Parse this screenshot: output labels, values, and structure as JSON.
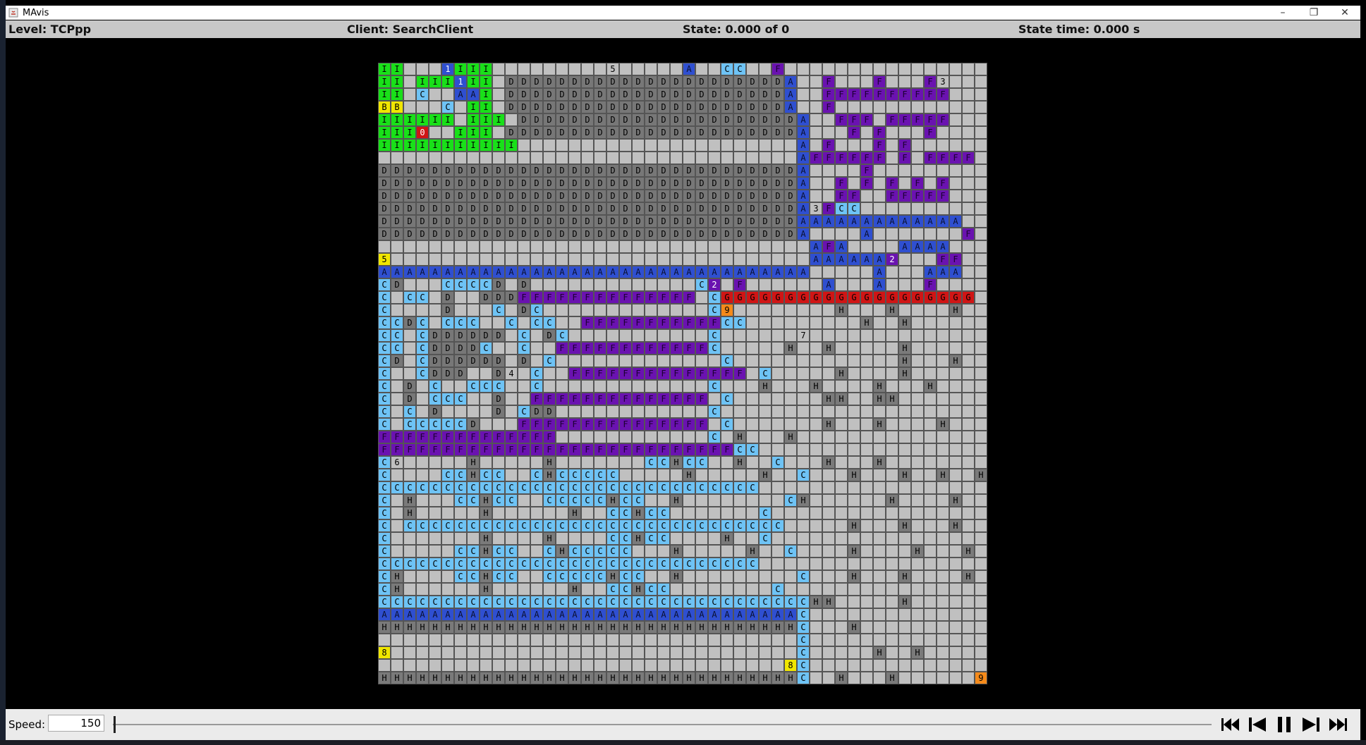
{
  "window": {
    "title": "MAvis"
  },
  "info": {
    "level": "Level: TCPpp",
    "client": "Client: SearchClient",
    "state": "State: 0.000 of 0",
    "state_time": "State time: 0.000 s"
  },
  "colors": {
    "A": "#2f4fd0",
    "B": "#f0e600",
    "C": "#6ec3f5",
    "D": "#777777",
    "E": "#d01515",
    "F": "#6a12b0",
    "G": "#d01515",
    "H": "#7a7a7a",
    "I": "#19e019",
    "8": "#f0e600",
    "9": "#f58a1a",
    "empty": "#c0c0c0",
    "wall": "#000000"
  },
  "grid_rows": [
    "II   1III         5     A  CC  F ",
    "II III1II DDDDDDDDDDDDDDDDDDDDDDA  F   F   F3",
    "II C  AAI DDDDDDDDDDDDDDDDDDDDDDA  FFFFFFFFFF",
    "BB   C II DDDDDDDDDDDDDDDDDDDDDDA  F ",
    "IIIIII III DDDDDDDDDDDDDDDDDDDDDDA  FFF FFFFF",
    "III0  III DDDDDDDDDDDDDDDDDDDDDDDA   F F   F",
    "IIIIIIIIIII                      A F   F F",
    "                                 AFFFFFF F FFFF",
    "DDDDDDDDDDDDDDDDDDDDDDDDDDDDDDDDDA    F",
    "DDDDDDDDDDDDDDDDDDDDDDDDDDDDDDDDDA  F F F F F",
    "DDDDDDDDDDDDDDDDDDDDDDDDDDDDDDDDDA  FF  FFFFF",
    "DDDDDDDDDDDDDDDDDDDDDDDDDDDDDDDDDA3FCC",
    "DDDDDDDDDDDDDDDDDDDDDDDDDDDDDDDDDAAAAAAAAAAAAA",
    "DDDDDDDDDDDDDDDDDDDDDDDDDDDDDDDDDA    A       F",
    "                                  AFA    AAAA",
    "5                                 AAAAAA2   FF",
    "AAAAAAAAAAAAAAAAAAAAAAAAAAAAAAAAAA     A   AAA",
    "CD   CCCCD D             C2 F      A   A   F",
    "C CC D  DDDFFFFFFFFFFFFFF CGGGGGGGGGGGGGGGGGGGG",
    "C    D   C DC             C9        H   H    H",
    "CCDC CCC  C CC  FFFFFFFFFFFCC         H  H",
    "CC CDDDDDD C DC           C      7",
    "CC CDDDDC  C  FFFFFFFFFFFFC     H  H     H",
    "CD CDDDDDD D C             C             H   H",
    "C  CDDD  D4 C  FFFFFFFFFFFFFF C     H    H",
    "C D C  CCC  C             C   H   H    H   H",
    "C D CCC  D  FFFFFFFFFFFFFF C       HH  HH",
    "C C D    D CDD            C",
    "C CCCCCD   FFFFFFFFFFFFFFF C       H   H    H",
    "FFFFFFFFFFFFFF            C H   H",
    "FFFFFFFFFFFFFFFFFFFFFFFFFFFFCC",
    "C6     H     H       CCHCC  H  C   H   H",
    "C    CCHCC  CHCCCCC     H     H  C   H   H  H  H",
    "CCCCCCCCCCCCCCCCCCCCCCCCCCCCCC",
    "C H   CCHCC  CCCCCHCC  H        CH      H    H    H",
    "C H     H      H  CCHCC       C",
    "C CCCCCCCCCCCCCCCCCCCCCCCCCCCCCC     H   H   H    H",
    "C       H    H    CCHCC    H  C",
    "C     CCHCC  CHCCCCC   H     H  C    H    H   H",
    "CCCCCCCCCCCCCCCCCCCCCCCCCCCCCC",
    "CH    CCHCC  CCCCCHCC  H         C   H   H    H   H",
    "CH      H      H  CCHCC        C",
    "CCCCCCCCCCCCCCCCCCCCCCCCCCCCCCCCCCHH     H",
    "AAAAAAAAAAAAAAAAAAAAAAAAAAAAAAAAAC",
    "HHHHHHHHHHHHHHHHHHHHHHHHHHHHHHHHHC   H",
    "                                 C",
    "8                                C     H  H",
    "                                8C",
    "HHHHHHHHHHHHHHHHHHHHHHHHHHHHHHHHHC  H   H      9"
  ],
  "speed": {
    "label": "Speed:",
    "value": "150"
  },
  "controls": [
    "skip-to-start",
    "step-back",
    "pause",
    "step-forward",
    "skip-to-end"
  ]
}
